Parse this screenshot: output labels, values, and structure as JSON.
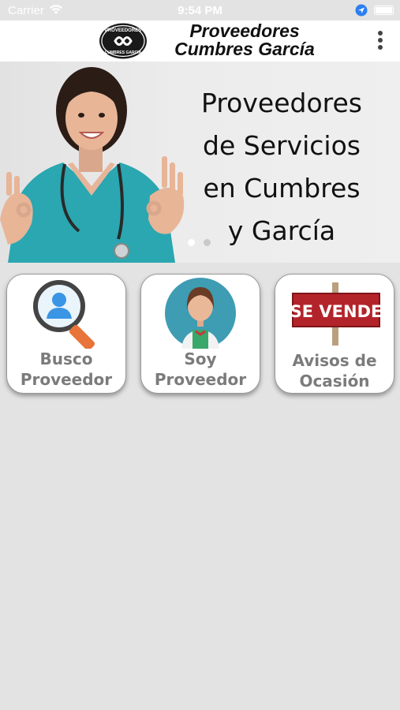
{
  "status_bar": {
    "carrier": "Carrier",
    "time": "9:54 PM",
    "battery_level": 1.0
  },
  "navbar": {
    "logo_text_top": "PROVEEDORES",
    "logo_text_bottom": "CUMBRES GARCIA",
    "brand_line1": "Proveedores",
    "brand_line2": "Cumbres García",
    "menu_icon": "more-vertical-icon"
  },
  "banner": {
    "lines": [
      "Proveedores",
      "de Servicios",
      "en Cumbres",
      "y García"
    ],
    "slide_count": 2,
    "active_slide": 1
  },
  "cards": [
    {
      "line1": "Busco",
      "line2": "Proveedor",
      "icon": "search-user-icon"
    },
    {
      "line1": "Soy",
      "line2": "Proveedor",
      "icon": "provider-avatar-icon"
    },
    {
      "line1": "Avisos de",
      "line2": "Ocasión",
      "icon": "se-vende-sign-icon",
      "sign_text": "SE VENDE"
    }
  ],
  "colors": {
    "background": "#e3e3e3",
    "scrub_teal": "#2aa7b0",
    "magnifier_orange": "#e8743b",
    "sign_red": "#b3242a",
    "avatar_circle": "#3e9cb3"
  }
}
